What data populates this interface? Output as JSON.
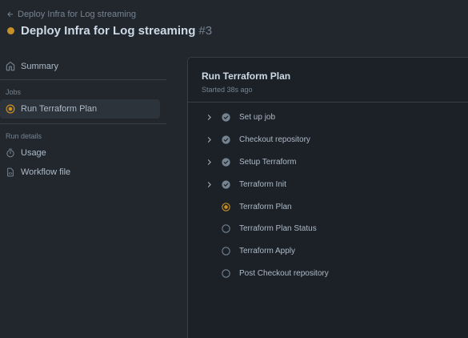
{
  "header": {
    "back_label": "Deploy Infra for Log streaming",
    "title": "Deploy Infra for Log streaming",
    "run_number": "#3",
    "status_color": "#c69026"
  },
  "sidebar": {
    "summary_label": "Summary",
    "jobs_label": "Jobs",
    "job_item_label": "Run Terraform Plan",
    "run_details_label": "Run details",
    "usage_label": "Usage",
    "workflow_file_label": "Workflow file"
  },
  "job": {
    "title": "Run Terraform Plan",
    "started": "Started 38s ago",
    "steps": [
      {
        "label": "Set up job",
        "status": "success",
        "expandable": true
      },
      {
        "label": "Checkout repository",
        "status": "success",
        "expandable": true
      },
      {
        "label": "Setup Terraform",
        "status": "success",
        "expandable": true
      },
      {
        "label": "Terraform Init",
        "status": "success",
        "expandable": true
      },
      {
        "label": "Terraform Plan",
        "status": "in_progress",
        "expandable": false
      },
      {
        "label": "Terraform Plan Status",
        "status": "queued",
        "expandable": false
      },
      {
        "label": "Terraform Apply",
        "status": "queued",
        "expandable": false
      },
      {
        "label": "Post Checkout repository",
        "status": "queued",
        "expandable": false
      }
    ]
  },
  "colors": {
    "success": "#768390",
    "in_progress": "#c69026",
    "queued": "#768390"
  }
}
